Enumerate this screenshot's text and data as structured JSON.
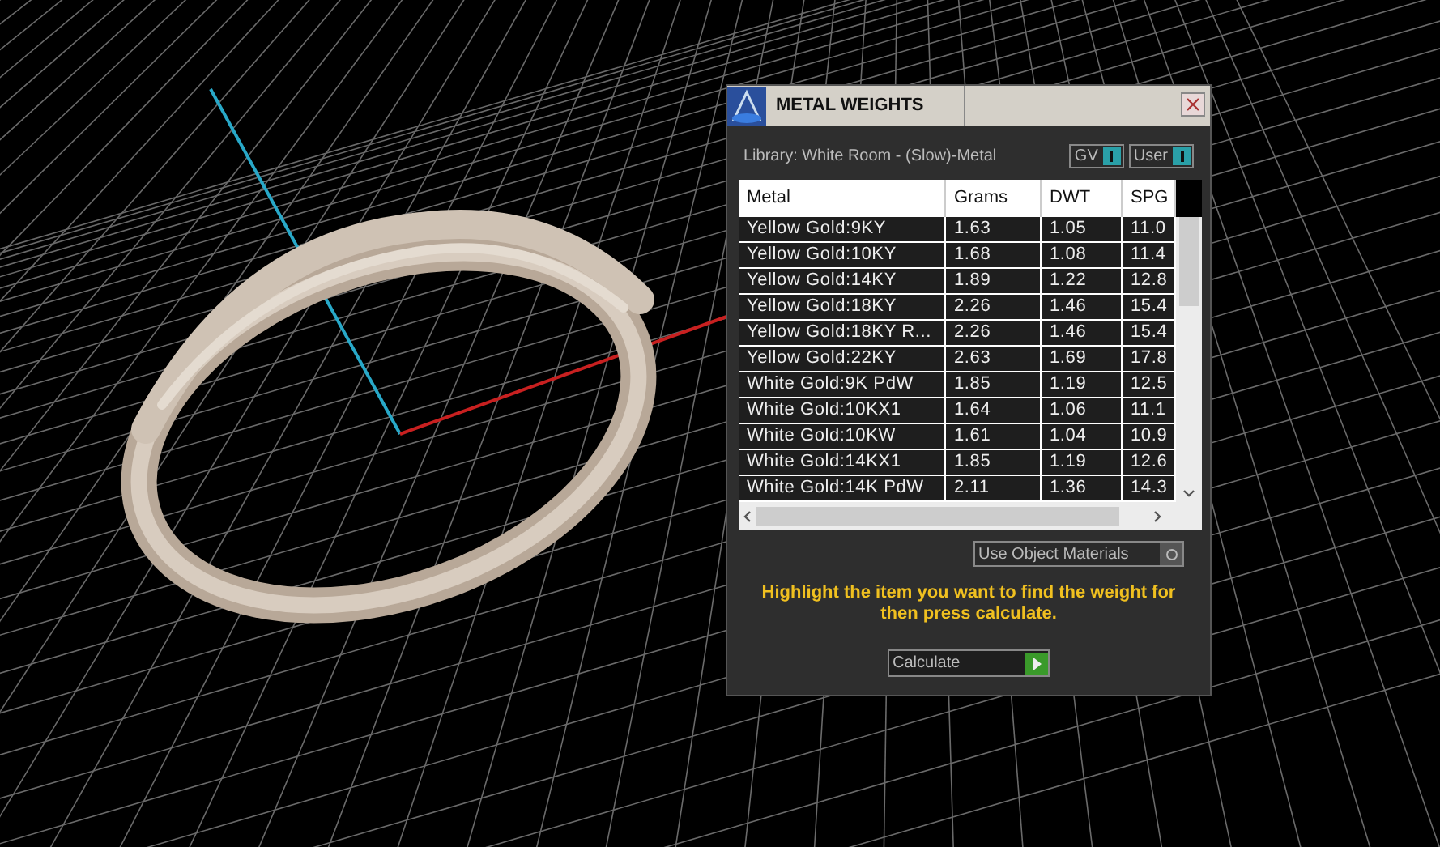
{
  "window": {
    "title": "METAL WEIGHTS"
  },
  "library": "Library: White Room - (Slow)-Metal",
  "toggles": [
    {
      "label": "GV",
      "on": true
    },
    {
      "label": "User",
      "on": true
    }
  ],
  "table": {
    "columns": [
      "Metal",
      "Grams",
      "DWT",
      "SPG"
    ],
    "rows": [
      [
        "Yellow Gold:9KY",
        "1.63",
        "1.05",
        "11.0"
      ],
      [
        "Yellow Gold:10KY",
        "1.68",
        "1.08",
        "11.4"
      ],
      [
        "Yellow Gold:14KY",
        "1.89",
        "1.22",
        "12.8"
      ],
      [
        "Yellow Gold:18KY",
        "2.26",
        "1.46",
        "15.4"
      ],
      [
        "Yellow Gold:18KY R...",
        "2.26",
        "1.46",
        "15.4"
      ],
      [
        "Yellow Gold:22KY",
        "2.63",
        "1.69",
        "17.8"
      ],
      [
        "White Gold:9K PdW",
        "1.85",
        "1.19",
        "12.5"
      ],
      [
        "White Gold:10KX1",
        "1.64",
        "1.06",
        "11.1"
      ],
      [
        "White Gold:10KW",
        "1.61",
        "1.04",
        "10.9"
      ],
      [
        "White Gold:14KX1",
        "1.85",
        "1.19",
        "12.6"
      ],
      [
        "White Gold:14K PdW",
        "2.11",
        "1.36",
        "14.3"
      ]
    ]
  },
  "use_object_materials": {
    "label": "Use Object Materials",
    "on": false
  },
  "hint": "Highlight the item you want to find the weight for then press calculate.",
  "calculate_button": "Calculate"
}
